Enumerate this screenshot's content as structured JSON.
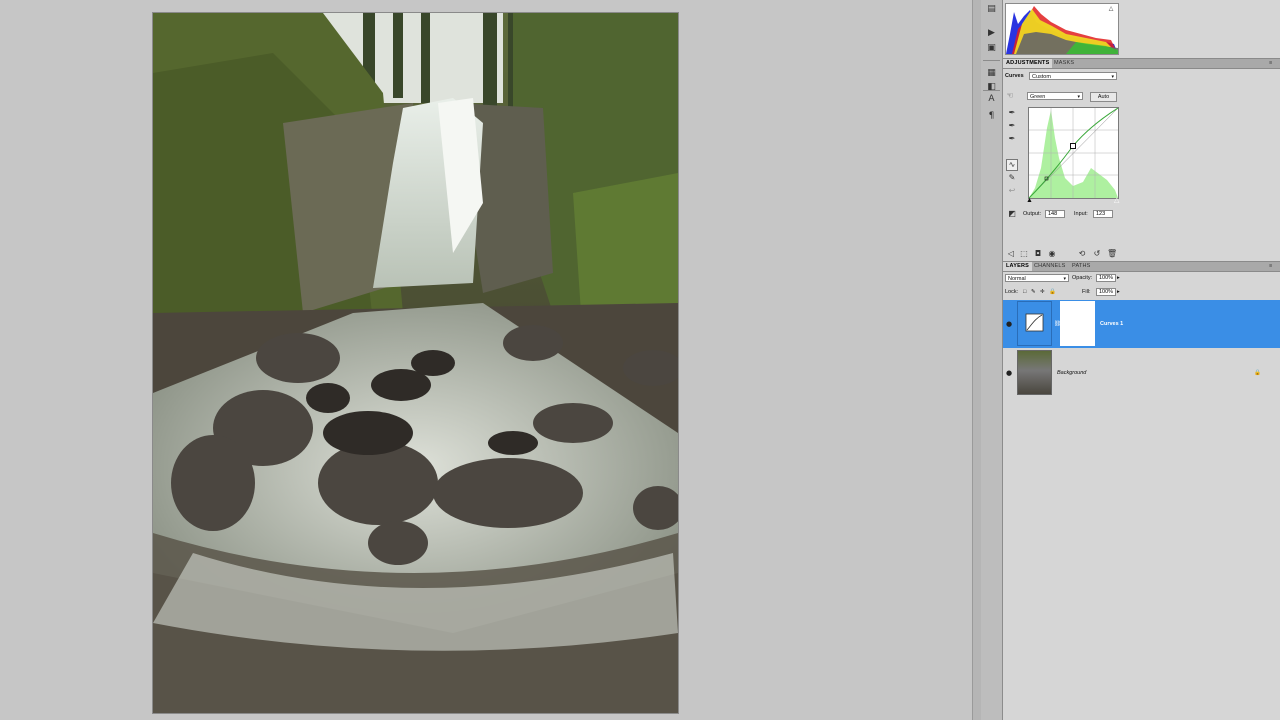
{
  "adjustments_panel": {
    "tabs": [
      "ADJUSTMENTS",
      "MASKS"
    ],
    "preset_label": "Curves",
    "preset_value": "Custom",
    "channel_value": "Green",
    "auto_label": "Auto",
    "output_label": "Output:",
    "output_value": "148",
    "input_label": "Input:",
    "input_value": "123",
    "curve_color": "#3aa83a",
    "histogram_fill": "#aef0a0"
  },
  "layers_panel": {
    "tabs": [
      "LAYERS",
      "CHANNELS",
      "PATHS"
    ],
    "blend_mode": "Normal",
    "opacity_label": "Opacity:",
    "opacity_value": "100%",
    "lock_label": "Lock:",
    "fill_label": "Fill:",
    "fill_value": "100%",
    "layers": [
      {
        "name": "Curves 1",
        "selected": true
      },
      {
        "name": "Background",
        "selected": false
      }
    ],
    "selection_color": "#3a8ee6"
  },
  "toolstrip": {
    "icons": [
      "history-icon",
      "actions-icon",
      "navigator-icon",
      "histogram-panel-icon",
      "adjustments-panel-icon",
      "character-icon",
      "paragraph-icon"
    ]
  }
}
